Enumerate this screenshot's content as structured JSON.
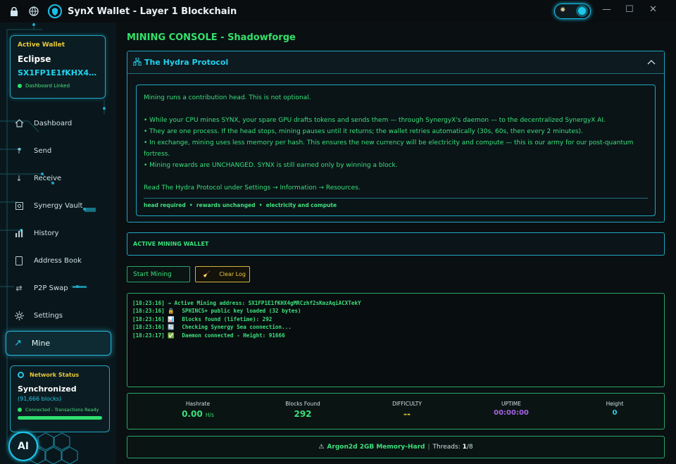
{
  "window": {
    "title": "SynX Wallet - Layer 1 Blockchain",
    "minimize": "—",
    "maximize": "☐",
    "close": "✕"
  },
  "wallet": {
    "label": "Active Wallet",
    "name": "Eclipse",
    "address": "SX1FP1E1fKHX4gMRC...",
    "status": "Dashboard Linked"
  },
  "nav": [
    {
      "label": "Dashboard",
      "icon": "home-icon"
    },
    {
      "label": "Send",
      "icon": "arrow-up-icon"
    },
    {
      "label": "Receive",
      "icon": "arrow-down-icon"
    },
    {
      "label": "Synergy Vault",
      "icon": "vault-icon"
    },
    {
      "label": "History",
      "icon": "bar-chart-icon"
    },
    {
      "label": "Address Book",
      "icon": "book-icon"
    },
    {
      "label": "P2P Swap",
      "icon": "swap-icon"
    },
    {
      "label": "Settings",
      "icon": "gear-icon"
    },
    {
      "label": "Mine",
      "icon": "trend-up-icon"
    }
  ],
  "network": {
    "title": "Network Status",
    "state": "Synchronized",
    "blocks": "(91,666 blocks)",
    "connection": "Connected - Transactions Ready",
    "progress": 1.0
  },
  "ai_button": "AI",
  "main": {
    "title": "MINING CONSOLE - Shadowforge",
    "hydra": {
      "header": "The Hydra Protocol",
      "intro": "Mining runs a contribution head. This is not optional.",
      "bullets": [
        "• While your CPU mines SYNX, your spare GPU drafts tokens and sends them — through SynergyX's daemon — to the decentralized SynergyX AI.",
        "• They are one process. If the head stops, mining pauses until it returns; the wallet retries automatically (30s, 60s, then every 2 minutes).",
        "• In exchange, mining uses less memory per hash. This ensures the new currency will be electricity and compute — this is our army for our post-quantum fortress.",
        "• Mining rewards are UNCHANGED. SYNX is still earned only by winning a block."
      ],
      "read_more": "Read The Hydra Protocol under Settings → Information → Resources.",
      "tags": "head required  •  rewards unchanged  •  electricity and compute"
    },
    "active_mining_wallet": "ACTIVE MINING WALLET",
    "start_button": "Start Mining",
    "clear_button": "Clear Log",
    "log": [
      {
        "time": "[18:23:16]",
        "icon": "→",
        "text": "Active Mining address: SX1FP1E1fKHX4gMRCzhf2sKmzAqiACXTekY"
      },
      {
        "time": "[18:23:16]",
        "icon": "🔒",
        "text": "SPHINCS+ public key loaded (32 bytes)"
      },
      {
        "time": "[18:23:16]",
        "icon": "📊",
        "text": "Blocks found (lifetime): 292"
      },
      {
        "time": "[18:23:16]",
        "icon": "🔄",
        "text": "Checking Synergy Sea connection..."
      },
      {
        "time": "[18:23:17]",
        "icon": "✅",
        "text": "Daemon connected - Height: 91666"
      }
    ],
    "stats": {
      "hashrate": {
        "label": "Hashrate",
        "value": "0.00",
        "unit": "H/s",
        "color": "#37e07a"
      },
      "blocks": {
        "label": "Blocks Found",
        "value": "292",
        "color": "#37e07a"
      },
      "difficulty": {
        "label": "DIFFICULTY",
        "value": "--",
        "color": "#e8c93a"
      },
      "uptime": {
        "label": "UPTIME",
        "value": "00:00:00",
        "color": "#a464e4"
      },
      "height": {
        "label": "Height",
        "value": "0",
        "color": "#23d1ee"
      }
    },
    "algo": {
      "name": "Argon2d 2GB Memory-Hard",
      "sep": "|",
      "threads_label": "Threads:",
      "threads_current": "1",
      "threads_total": "/8"
    }
  },
  "colors": {
    "accent": "#1fa6c2",
    "green": "#37e07a",
    "yellow": "#e8c93a",
    "purple": "#a464e4"
  }
}
